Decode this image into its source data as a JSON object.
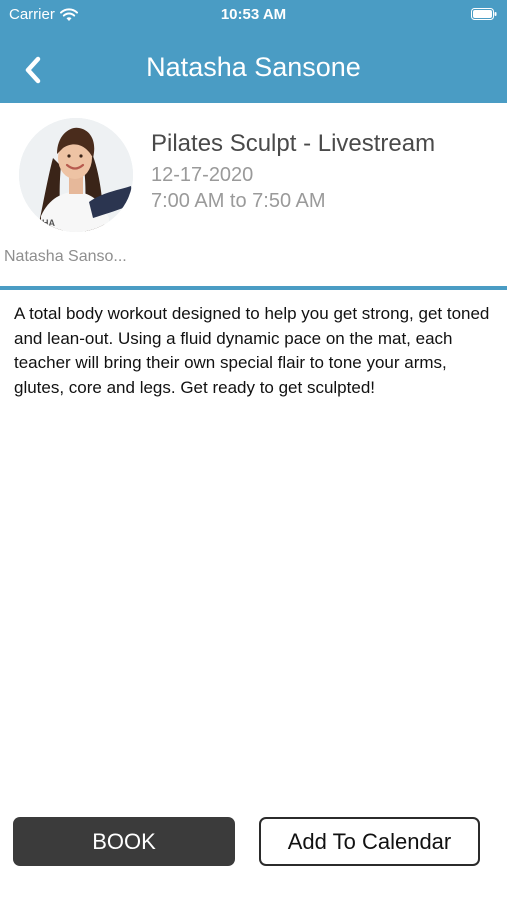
{
  "status_bar": {
    "carrier": "Carrier",
    "time": "10:53 AM",
    "wifi_icon": "wifi-icon",
    "battery_icon": "battery-icon"
  },
  "nav": {
    "back_icon": "chevron-left-icon",
    "title": "Natasha Sansone"
  },
  "instructor": {
    "name_label": "Natasha Sanso...",
    "photo_caption": "SHA"
  },
  "class_info": {
    "title": "Pilates Sculpt - Livestream",
    "date": "12-17-2020",
    "time": "7:00 AM to 7:50 AM"
  },
  "description": "A total body workout designed to help you get strong, get toned and lean-out. Using a fluid dynamic pace on the mat, each teacher will bring their own special flair to tone your arms, glutes, core and legs. Get ready to get sculpted!",
  "actions": {
    "book_label": "BOOK",
    "calendar_label": "Add To Calendar"
  },
  "colors": {
    "header": "#4a9cc4",
    "book_button": "#3b3b3b",
    "secondary_text": "#9a9a9a"
  }
}
